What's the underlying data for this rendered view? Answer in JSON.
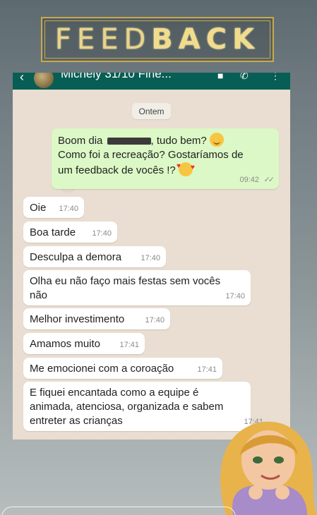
{
  "banner": {
    "text_light": "FEED",
    "text_bold": "BACK"
  },
  "topbar": {
    "contact_name": "Michely 31/10 Fine...",
    "back_icon": "arrow-left-icon"
  },
  "date_pill": "Ontem",
  "outgoing": {
    "greeting_pre": "Boom dia",
    "greeting_post": ", tudo bem?",
    "line2": "Como foi a recreação? Gostaríamos de",
    "line3": "um feedback de vocês !?",
    "time": "09:42",
    "ticks": "✓✓"
  },
  "messages": [
    {
      "text": "Oie",
      "time": "17:40"
    },
    {
      "text": "Boa tarde",
      "time": "17:40"
    },
    {
      "text": "Desculpa a demora",
      "time": "17:40"
    },
    {
      "text": "Olha eu não faço mais festas sem vocês",
      "text2": "não",
      "time": "17:40"
    },
    {
      "text": "Melhor investimento",
      "time": "17:40"
    },
    {
      "text": "Amamos muito",
      "time": "17:41"
    },
    {
      "text": "Me emocionei com a coroação",
      "time": "17:41"
    },
    {
      "text": "E fiquei encantada como a equipe é",
      "text2": "animada, atenciosa, organizada e sabem",
      "text3": "entreter as crianças",
      "time": "17:41"
    }
  ],
  "colors": {
    "outgoing_bubble": "#dcf8c6",
    "incoming_bubble": "#ffffff",
    "chat_bg": "#e9ded1",
    "banner_gold": "#c9a94a"
  }
}
